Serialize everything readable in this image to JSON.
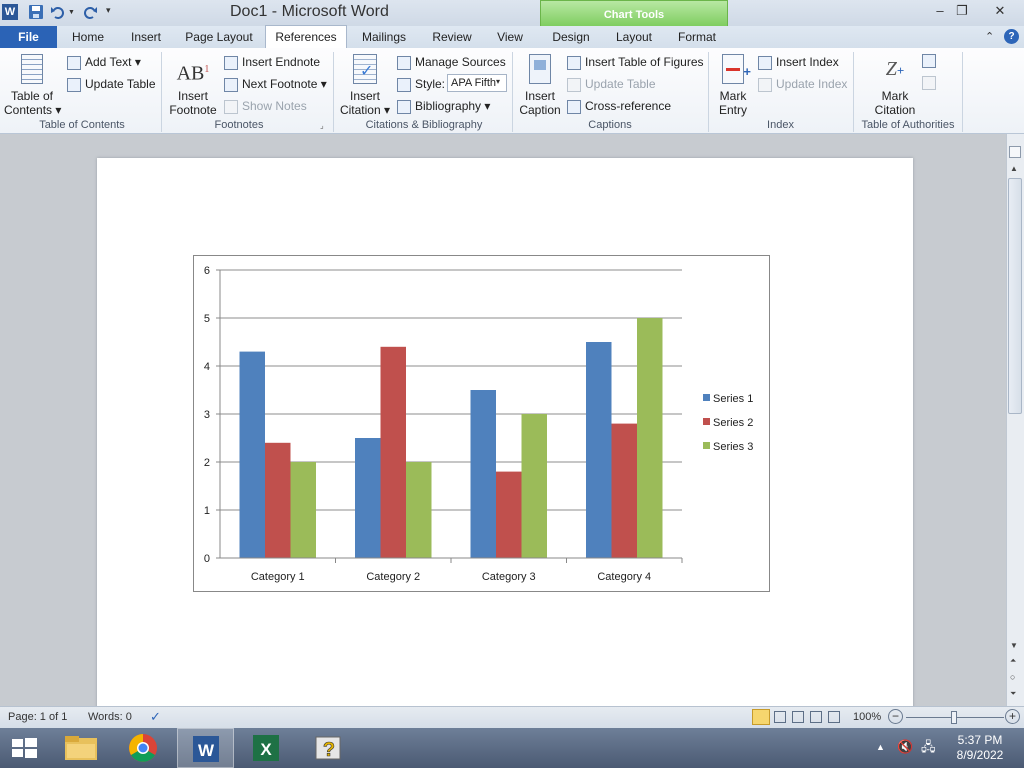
{
  "window": {
    "doc_title": "Doc1  -  Microsoft Word",
    "context_tab_group": "Chart Tools"
  },
  "tabs": [
    {
      "label": "File"
    },
    {
      "label": "Home"
    },
    {
      "label": "Insert"
    },
    {
      "label": "Page Layout"
    },
    {
      "label": "References"
    },
    {
      "label": "Mailings"
    },
    {
      "label": "Review"
    },
    {
      "label": "View"
    },
    {
      "label": "Design"
    },
    {
      "label": "Layout"
    },
    {
      "label": "Format"
    }
  ],
  "ribbon": {
    "toc": {
      "big_label_1": "Table of",
      "big_label_2": "Contents",
      "add_text": "Add Text",
      "update_table": "Update Table",
      "group": "Table of Contents"
    },
    "footnotes": {
      "big_label_1": "Insert",
      "big_label_2": "Footnote",
      "insert_endnote": "Insert Endnote",
      "next_footnote": "Next Footnote",
      "show_notes": "Show Notes",
      "group": "Footnotes"
    },
    "citations": {
      "big_label_1": "Insert",
      "big_label_2": "Citation",
      "manage_sources": "Manage Sources",
      "style_label": "Style:",
      "style_value": "APA Fifth",
      "bibliography": "Bibliography",
      "group": "Citations & Bibliography"
    },
    "captions": {
      "big_label_1": "Insert",
      "big_label_2": "Caption",
      "insert_tof": "Insert Table of Figures",
      "update_table": "Update Table",
      "cross_reference": "Cross-reference",
      "group": "Captions"
    },
    "index": {
      "big_label_1": "Mark",
      "big_label_2": "Entry",
      "insert_index": "Insert Index",
      "update_index": "Update Index",
      "group": "Index"
    },
    "toa": {
      "big_label_1": "Mark",
      "big_label_2": "Citation",
      "group": "Table of Authorities"
    }
  },
  "chart_data": {
    "type": "bar",
    "categories": [
      "Category 1",
      "Category 2",
      "Category 3",
      "Category 4"
    ],
    "series": [
      {
        "name": "Series 1",
        "color": "#4f81bd",
        "values": [
          4.3,
          2.5,
          3.5,
          4.5
        ]
      },
      {
        "name": "Series 2",
        "color": "#c0504d",
        "values": [
          2.4,
          4.4,
          1.8,
          2.8
        ]
      },
      {
        "name": "Series 3",
        "color": "#9bbb59",
        "values": [
          2.0,
          2.0,
          3.0,
          5.0
        ]
      }
    ],
    "ylim": [
      0,
      6
    ],
    "yticks": [
      "0",
      "1",
      "2",
      "3",
      "4",
      "5",
      "6"
    ],
    "grid": true,
    "legend": "right"
  },
  "status": {
    "page": "Page: 1 of 1",
    "words": "Words: 0",
    "zoom": "100%"
  },
  "taskbar": {
    "time": "5:37 PM",
    "date": "8/9/2022"
  }
}
